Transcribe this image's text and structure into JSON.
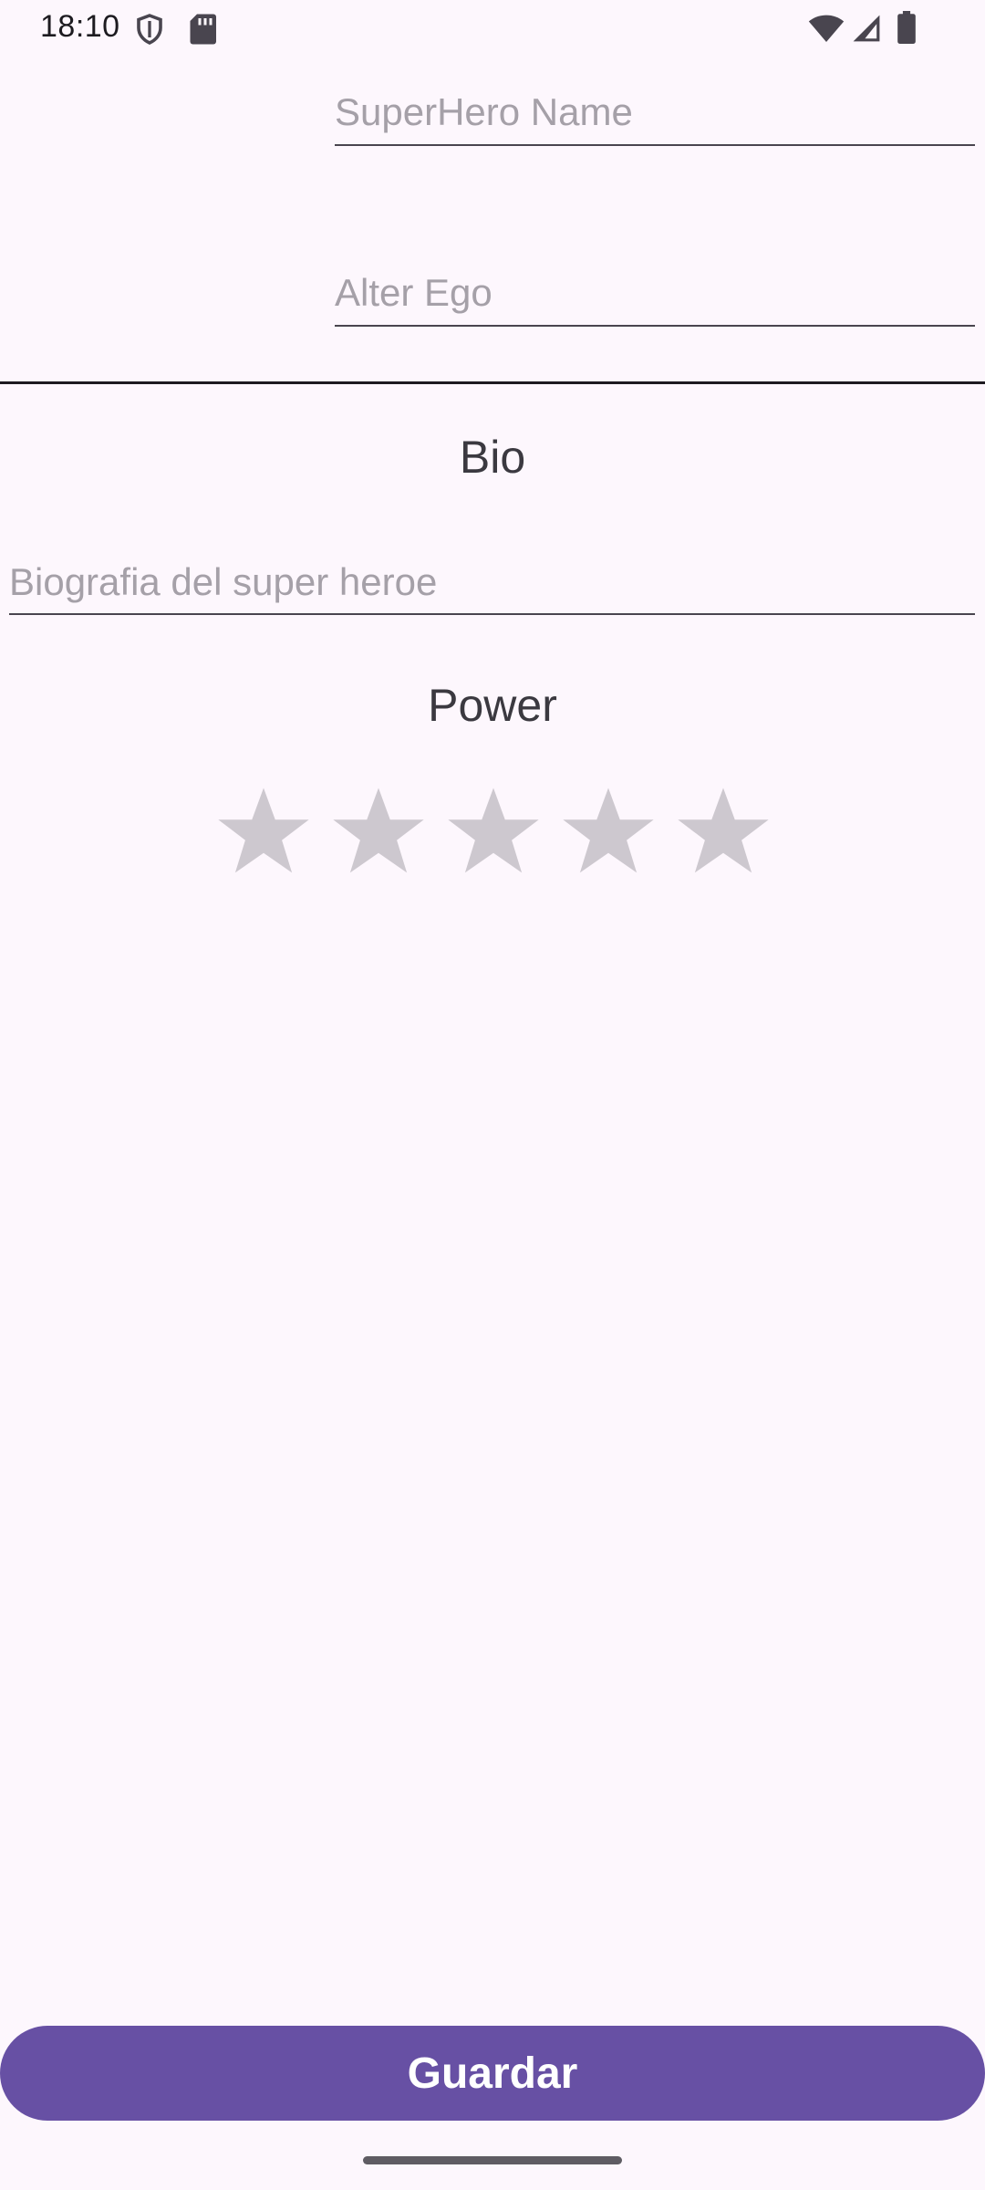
{
  "status_bar": {
    "time": "18:10",
    "icons_left": [
      "shield-icon",
      "sd-card-icon"
    ],
    "icons_right": [
      "wifi-icon",
      "cell-signal-icon",
      "battery-icon"
    ]
  },
  "form": {
    "superhero_name": {
      "value": "",
      "placeholder": "SuperHero Name"
    },
    "alter_ego": {
      "value": "",
      "placeholder": "Alter Ego"
    },
    "bio": {
      "label": "Bio",
      "value": "",
      "placeholder": "Biografia del super heroe"
    },
    "power": {
      "label": "Power",
      "rating": 0,
      "max_rating": 5
    }
  },
  "actions": {
    "save_label": "Guardar"
  },
  "colors": {
    "background": "#fdf7fd",
    "accent": "#6750a4",
    "star_inactive": "#cdc8cf"
  }
}
